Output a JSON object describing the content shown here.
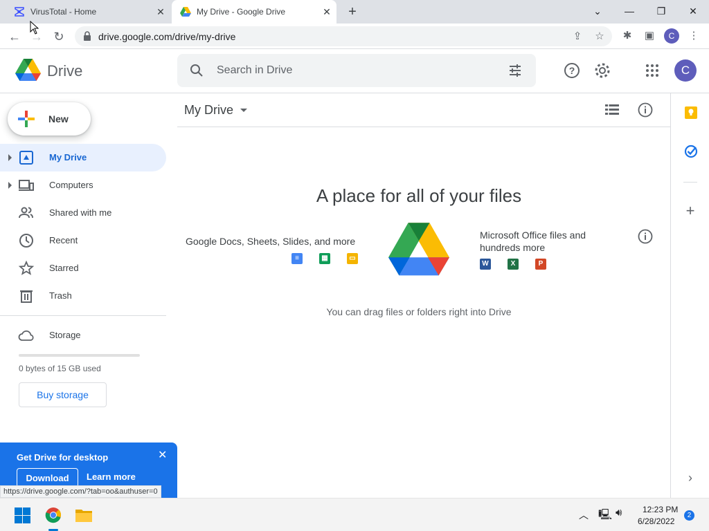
{
  "browser": {
    "tabs": [
      {
        "title": "VirusTotal - Home"
      },
      {
        "title": "My Drive - Google Drive"
      }
    ],
    "url": "drive.google.com/drive/my-drive",
    "status_url": "https://drive.google.com/?tab=oo&authuser=0",
    "profile_initial": "C"
  },
  "header": {
    "app_name": "Drive",
    "search_placeholder": "Search in Drive",
    "avatar_initial": "C"
  },
  "sidebar": {
    "new_label": "New",
    "items": [
      {
        "label": "My Drive",
        "icon": "my-drive-icon",
        "active": true
      },
      {
        "label": "Computers",
        "icon": "computers-icon"
      },
      {
        "label": "Shared with me",
        "icon": "shared-icon"
      },
      {
        "label": "Recent",
        "icon": "clock-icon"
      },
      {
        "label": "Starred",
        "icon": "star-icon"
      },
      {
        "label": "Trash",
        "icon": "trash-icon"
      }
    ],
    "storage_label": "Storage",
    "storage_used": "0 bytes of 15 GB used",
    "storage_fraction": 0,
    "buy_storage": "Buy storage"
  },
  "promo": {
    "title": "Get Drive for desktop",
    "download": "Download",
    "learn_more": "Learn more"
  },
  "main": {
    "title": "My Drive",
    "empty_title": "A place for all of your files",
    "docs_text": "Google Docs, Sheets, Slides, and more",
    "office_text": "Microsoft Office files and hundreds more",
    "office_icons": [
      "W",
      "X",
      "P"
    ],
    "drag_text": "You can drag files or folders right into Drive"
  },
  "taskbar": {
    "time": "12:23 PM",
    "date": "6/28/2022",
    "notifications": "2"
  },
  "colors": {
    "accent": "#1a73e8",
    "active_nav_bg": "#e8f0fe"
  }
}
